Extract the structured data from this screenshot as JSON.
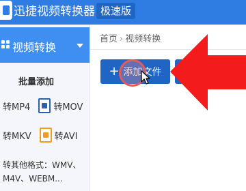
{
  "titlebar": {
    "app_title": "迅捷视频转换器",
    "speed_badge": "极速版",
    "accent_color": "#2f7de2"
  },
  "sidebar": {
    "active_nav": {
      "label": "视频转换",
      "icon": "grid-icon",
      "caret": "chevron-down-icon"
    },
    "section_title": "批量添加",
    "formats": [
      {
        "label": "转MP4"
      },
      {
        "label": "转MOV",
        "icon": "mov-file-icon"
      },
      {
        "label": "转MKV"
      },
      {
        "label": "转AVI",
        "icon": "avi-file-icon"
      }
    ],
    "other_formats_line1": "转其他格式：WMV、",
    "other_formats_line2": "M4V、WEBM..."
  },
  "main": {
    "breadcrumb": {
      "home": "首页",
      "separator": "›",
      "current": "视频转换"
    },
    "add_file_button": {
      "plus": "+",
      "label": "添加文件"
    },
    "annotation_color": "#f31b1b"
  }
}
